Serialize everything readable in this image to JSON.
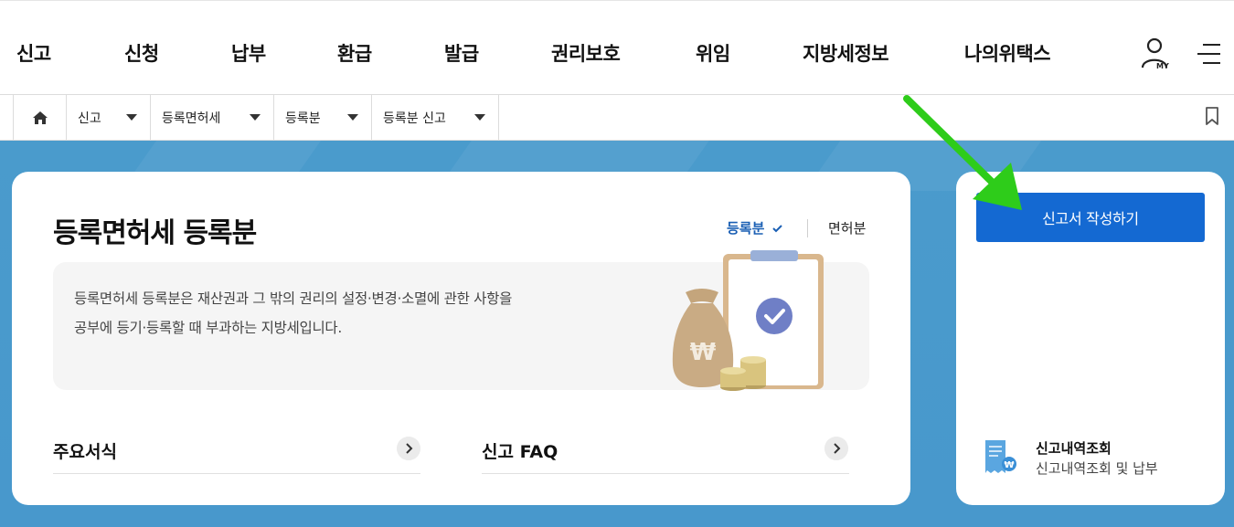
{
  "nav": {
    "items": [
      "신고",
      "신청",
      "납부",
      "환급",
      "발급",
      "권리보호",
      "위임",
      "지방세정보",
      "나의위택스"
    ],
    "my_label": "MY"
  },
  "breadcrumb": {
    "items": [
      "신고",
      "등록면허세",
      "등록분",
      "등록분 신고"
    ]
  },
  "page": {
    "title": "등록면허세 등록분",
    "tabs": {
      "active": "등록분",
      "other": "면허분"
    },
    "description": [
      "등록면허세 등록분은 재산권과 그 밖의 권리의 설정·변경·소멸에 관한 사항을",
      "공부에 등기·등록할 때 부과하는 지방세입니다."
    ],
    "links": [
      "주요서식",
      "신고 FAQ"
    ],
    "illustration_symbol": "₩"
  },
  "side": {
    "write_button": "신고서 작성하기",
    "history_title": "신고내역조회",
    "history_sub": "신고내역조회 및 납부"
  },
  "colors": {
    "primary_blue": "#1469d2",
    "background_blue": "#4898cc",
    "active_tab": "#1a5fb4",
    "annotation_arrow": "#2ecc1a"
  }
}
